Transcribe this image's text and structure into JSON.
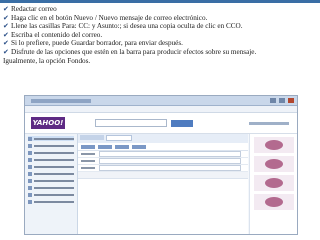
{
  "bullets": [
    "Redactar correo",
    "Haga clic en el botón Nuevo / Nuevo mensaje de correo electrónico.",
    "Llene las casillas Para: CC: y Asunto:; si desea una copia oculta de clic en CCO.",
    "Escriba el contenido del correo.",
    "Si lo prefiere,  puede Guardar borrador, para enviar después.",
    "Disfrute de las opciones que estén en la barra para producir efectos sobre su mensaje."
  ],
  "continuation": "Igualmente, la opción Fondos.",
  "screenshot": {
    "logo_text": "YAHOO!"
  },
  "colors": {
    "accent": "#3a6ea5",
    "logo": "#5e2a84"
  }
}
